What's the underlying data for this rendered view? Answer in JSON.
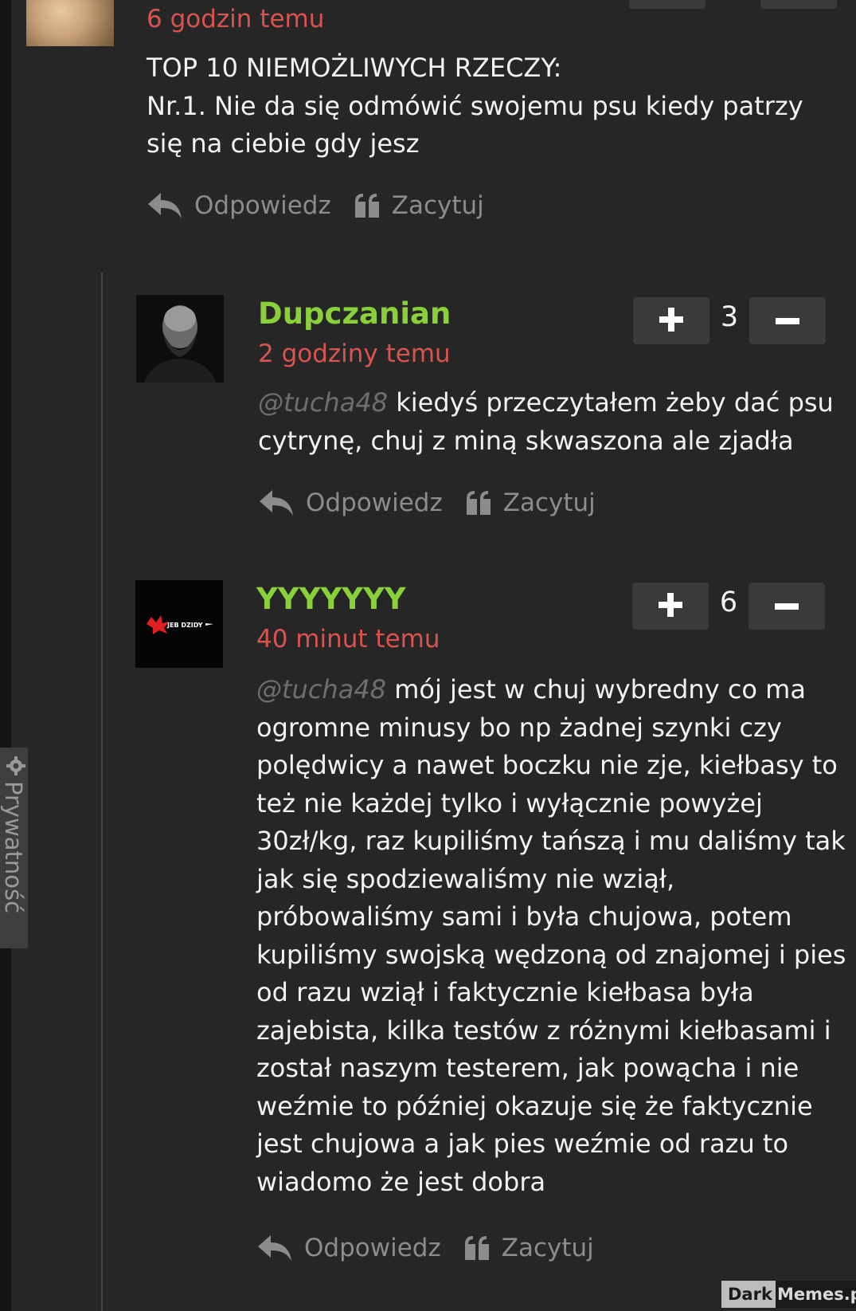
{
  "top_comment": {
    "timestamp": "6 godzin temu",
    "text_line1": "TOP 10 NIEMOŻLIWYCH RZECZY:",
    "text_line2": "Nr.1. Nie da się odmówić swojemu psu kiedy patrzy się na ciebie gdy jesz",
    "reply_label": "Odpowiedz",
    "quote_label": "Zacytuj"
  },
  "replies": [
    {
      "username": "Dupczanian",
      "timestamp": "2 godziny temu",
      "mention": "@tucha48",
      "text": "kiedyś przeczytałem żeby dać psu cytrynę, chuj z miną skwaszona ale zjadła",
      "score": "3",
      "upvote_label": "+",
      "downvote_label": "−",
      "reply_label": "Odpowiedz",
      "quote_label": "Zacytuj"
    },
    {
      "username": "YYYYYYY",
      "timestamp": "40 minut temu",
      "mention": "@tucha48",
      "text": "mój jest w chuj wybredny co ma ogromne minusy bo np żadnej szynki czy polędwicy a nawet boczku nie zje, kiełbasy to też nie każdej tylko i wyłącznie powyżej 30zł/kg, raz kupiliśmy tańszą i mu daliśmy tak jak się spodziewaliśmy nie wziął, próbowaliśmy sami i była chujowa, potem kupiliśmy swojską wędzoną od znajomej i pies od razu wziął i faktycznie kiełbasa była zajebista, kilka testów z różnymi kiełbasami i został naszym testerem, jak powącha i nie weźmie to później okazuje się że faktycznie jest chujowa a jak pies weźmie od razu to wiadomo że jest dobra",
      "score": "6",
      "upvote_label": "+",
      "downvote_label": "−",
      "reply_label": "Odpowiedz",
      "quote_label": "Zacytuj",
      "avatar_text": "JEB DZIDY"
    }
  ],
  "privacy_tab": {
    "label": "Prywatność",
    "icon": "gear-icon"
  },
  "watermark": {
    "part1": "Dark",
    "part2": "Memes.pl"
  },
  "colors": {
    "username": "#8ad03a",
    "timestamp": "#d9534f",
    "background": "#262626",
    "vote_button": "#3a3a3a",
    "muted": "#8c8c8c"
  }
}
